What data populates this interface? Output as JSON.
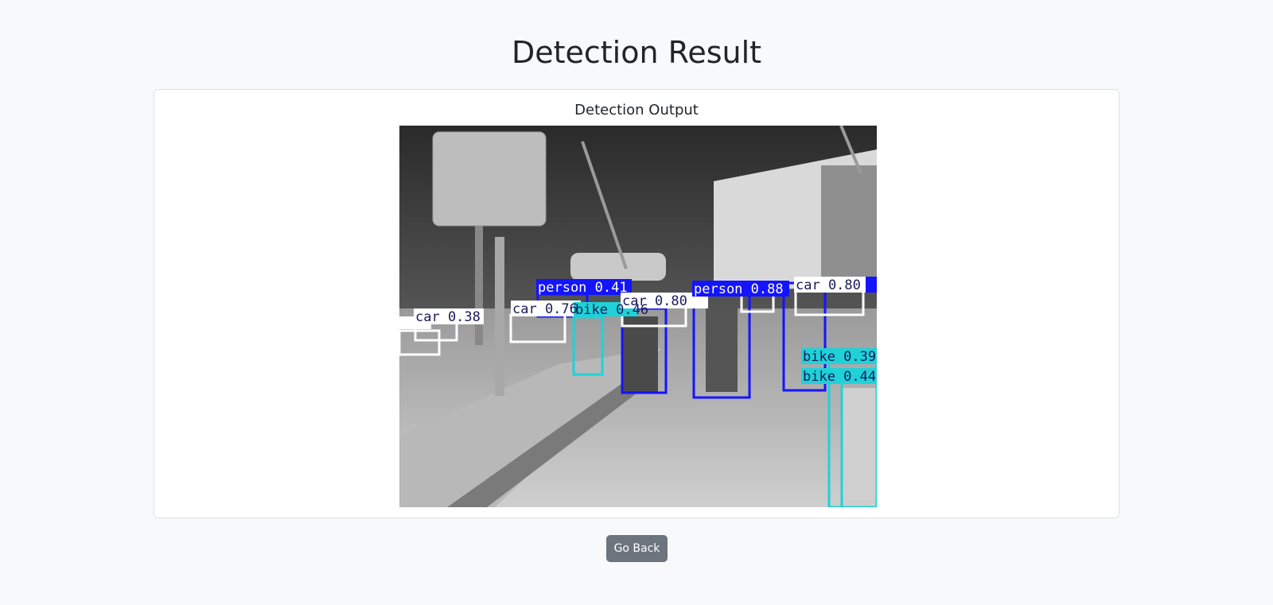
{
  "page": {
    "title": "Detection Result"
  },
  "card": {
    "title": "Detection Output"
  },
  "detections": [
    {
      "label": "person 0.41",
      "class": "person"
    },
    {
      "label": "car 0.76",
      "class": "car"
    },
    {
      "label": "car 0.38",
      "class": "car"
    },
    {
      "label": "bike 0.46",
      "class": "bike"
    },
    {
      "label": "car 0.80",
      "class": "car"
    },
    {
      "label": "person 0.88",
      "class": "person"
    },
    {
      "label": "car 0.80",
      "class": "car"
    },
    {
      "label": "bike 0.39",
      "class": "bike"
    },
    {
      "label": "bike 0.44",
      "class": "bike"
    }
  ],
  "colors": {
    "person": "#1414ff",
    "car": "#ffffff",
    "bike": "#1ed2d8",
    "label_text_dark": "#1a1a5a",
    "button_bg": "#6c757d"
  },
  "actions": {
    "go_back_label": "Go Back"
  }
}
